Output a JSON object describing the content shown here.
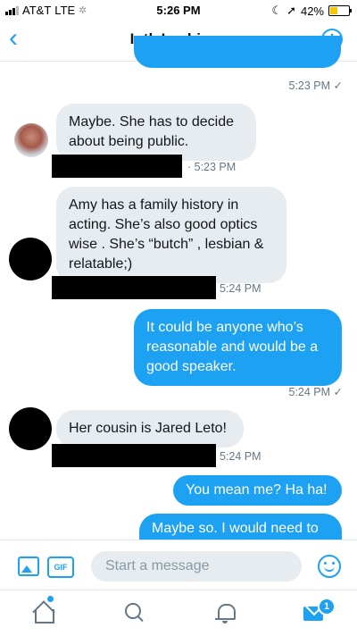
{
  "status_bar": {
    "carrier": "AT&T",
    "network": "LTE",
    "time": "5:26 PM",
    "battery_percent": "42%",
    "battery_level": 0.42
  },
  "header": {
    "back_icon": "chevron-left-icon",
    "title": "Intl. Lesbians",
    "info_label": "i"
  },
  "messages": [
    {
      "direction": "out",
      "text": "",
      "meta": "5:23 PM ✓"
    },
    {
      "direction": "in",
      "text": "Maybe. She has to decide about being public.",
      "meta": "· 5:23 PM",
      "avatar": "photo-avatar"
    },
    {
      "direction": "in",
      "text": "Amy has a family history in acting. She’s also good optics wise . She’s “butch” , lesbian & relatable;)",
      "meta": "5:24 PM",
      "avatar": "redacted-avatar"
    },
    {
      "direction": "out",
      "text": "It could be anyone who’s reasonable and would be a good speaker.",
      "meta": "5:24 PM ✓"
    },
    {
      "direction": "in",
      "text": "Her cousin is Jared Leto!",
      "meta": "5:24 PM",
      "avatar": "redacted-avatar"
    },
    {
      "direction": "out",
      "text": "You mean me? Ha ha!"
    },
    {
      "direction": "out",
      "text": "Maybe so. I would need to"
    }
  ],
  "composer": {
    "image_icon": "image-icon",
    "gif_label": "GIF",
    "placeholder": "Start a message",
    "emoji_icon": "emoji-icon"
  },
  "tab_bar": {
    "tabs": [
      "home-icon",
      "search-icon",
      "notifications-icon",
      "messages-icon"
    ],
    "messages_badge": "1"
  },
  "colors": {
    "accent": "#1da1f2",
    "incoming_bubble": "#e6ecf0",
    "meta_text": "#657786"
  }
}
